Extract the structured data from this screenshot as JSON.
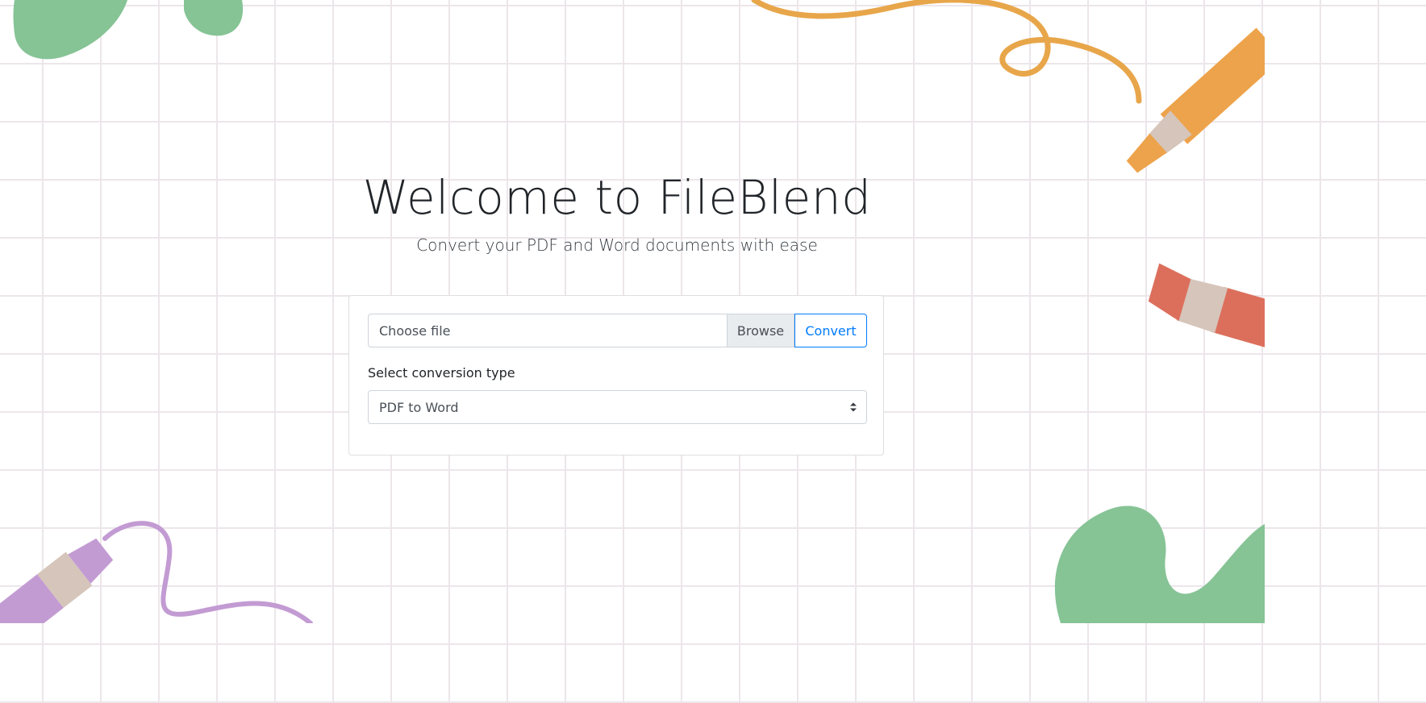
{
  "hero": {
    "title": "Welcome to FileBlend",
    "subtitle": "Convert your PDF and Word documents with ease"
  },
  "form": {
    "file_placeholder": "Choose file",
    "browse_label": "Browse",
    "convert_label": "Convert",
    "select_label": "Select conversion type",
    "selected_option": "PDF to Word"
  },
  "colors": {
    "primary": "#007bff",
    "grid_line": "#ece6ea",
    "blob_green": "#86c395",
    "marker_orange": "#eda34b",
    "marker_red": "#dc6f5c",
    "marker_purple": "#c39bd3",
    "marker_band": "#d6c5ba"
  }
}
